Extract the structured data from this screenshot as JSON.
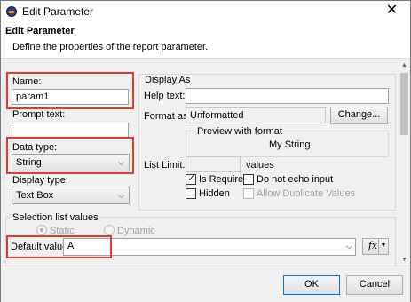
{
  "window": {
    "title": "Edit Parameter",
    "close_glyph": "✕"
  },
  "header": {
    "title": "Edit Parameter",
    "description": "Define the properties of the report parameter."
  },
  "name": {
    "label": "Name:",
    "value": "param1"
  },
  "prompt_text": {
    "label": "Prompt text:",
    "value": ""
  },
  "data_type": {
    "label": "Data type:",
    "value": "String"
  },
  "display_type": {
    "label": "Display type:",
    "value": "Text Box"
  },
  "display_as": {
    "label": "Display As",
    "help_text": {
      "label": "Help text:",
      "value": ""
    },
    "format_as": {
      "label": "Format as:",
      "value": "Unformatted",
      "button": "Change..."
    },
    "preview": {
      "label": "Preview with format",
      "value": "My String"
    },
    "list_limit": {
      "label": "List Limit:",
      "value": "",
      "unit": "values"
    },
    "checkboxes": {
      "is_required": {
        "label": "Is Required",
        "checked": true
      },
      "do_not_echo": {
        "label": "Do not echo input",
        "checked": false
      },
      "hidden": {
        "label": "Hidden",
        "checked": false
      },
      "allow_duplicates": {
        "label": "Allow Duplicate Values",
        "checked": false
      }
    }
  },
  "selection_list": {
    "label": "Selection list values",
    "static": "Static",
    "dynamic": "Dynamic",
    "selected": "Static"
  },
  "default_value": {
    "label": "Default value:",
    "value": "A",
    "fx": "fx"
  },
  "footer": {
    "ok": "OK",
    "cancel": "Cancel"
  },
  "colors": {
    "highlight": "#e33333",
    "window_bg": "#f0f0f0"
  },
  "icons": [
    "eclipse-app-icon",
    "close-icon",
    "chevron-down-icon",
    "checkmark-icon",
    "fx-expression-icon",
    "scroll-up-icon",
    "scroll-down-icon"
  ]
}
